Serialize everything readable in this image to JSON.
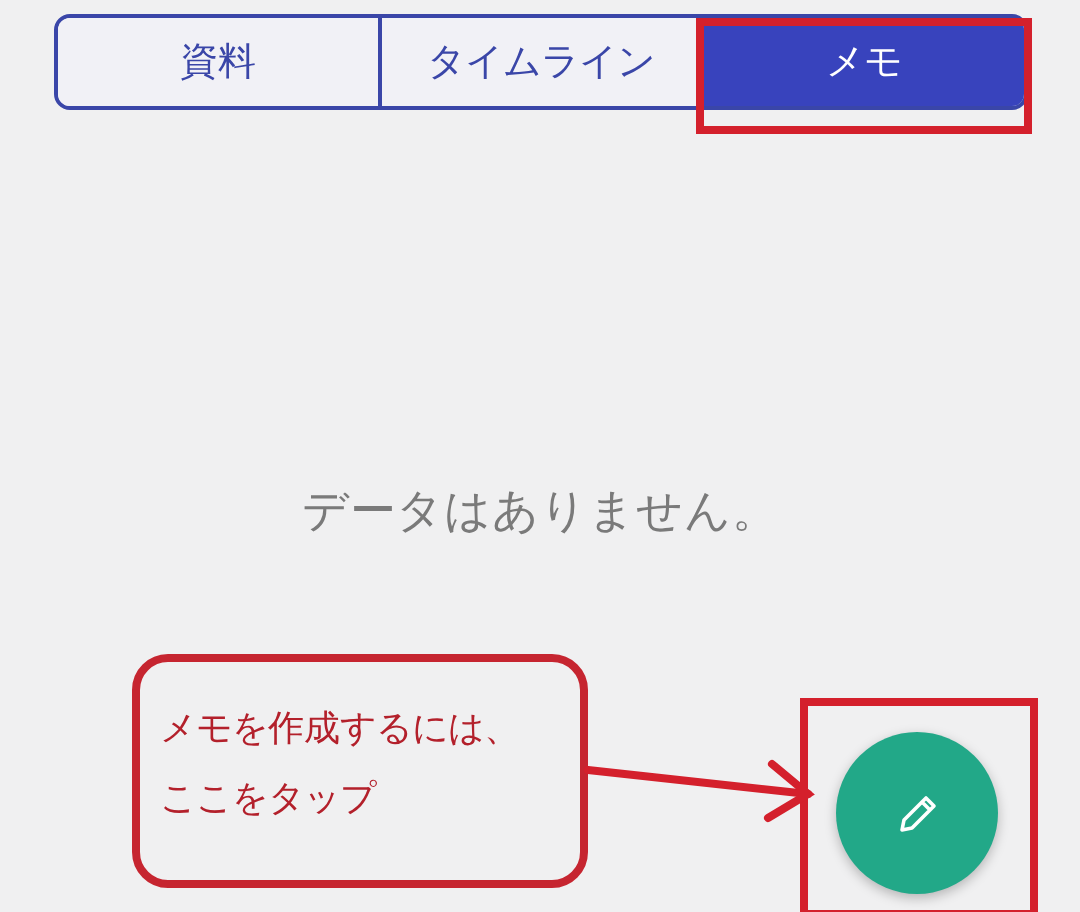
{
  "tabs": [
    {
      "label": "資料",
      "selected": false
    },
    {
      "label": "タイムライン",
      "selected": false
    },
    {
      "label": "メモ",
      "selected": true
    }
  ],
  "empty_message": "データはありません。",
  "annotation": {
    "lines": [
      "メモを作成するには、",
      "ここをタップ"
    ]
  }
}
